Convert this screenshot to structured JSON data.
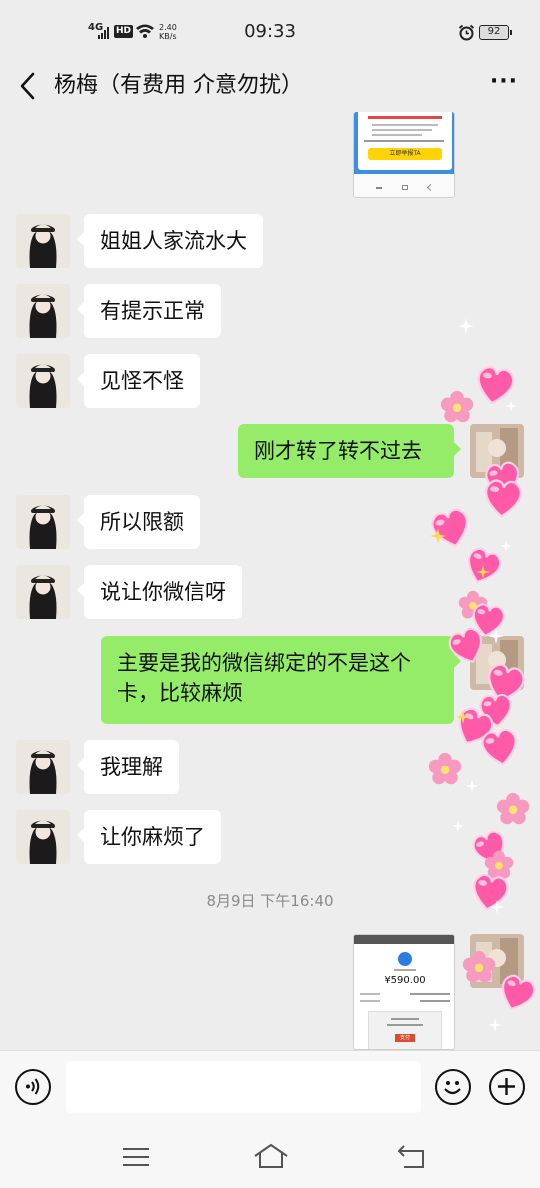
{
  "status_bar": {
    "network": "4G",
    "hd": "HD",
    "speed_value": "2.40",
    "speed_unit": "KB/s",
    "time": "09:33",
    "battery": "92"
  },
  "header": {
    "title": "杨梅（有费用 介意勿扰）",
    "more": "···"
  },
  "messages": [
    {
      "side": "left",
      "text": "姐姐人家流水大"
    },
    {
      "side": "left",
      "text": "有提示正常"
    },
    {
      "side": "left",
      "text": "见怪不怪"
    },
    {
      "side": "right",
      "text": "刚才转了转不过去"
    },
    {
      "side": "left",
      "text": "所以限额"
    },
    {
      "side": "left",
      "text": "说让你微信呀"
    },
    {
      "side": "right",
      "text": "主要是我的微信绑定的不是这个卡，比较麻烦"
    },
    {
      "side": "left",
      "text": "我理解"
    },
    {
      "side": "left",
      "text": "让你麻烦了"
    }
  ],
  "timestamp": "8月9日 下午16:40",
  "image_top": {
    "banner_button": "立即举报TA"
  },
  "image_bottom": {
    "amount": "¥590.00",
    "button": "支付"
  },
  "colors": {
    "background": "#ededed",
    "sent_bubble": "#95ec69",
    "received_bubble": "#ffffff",
    "sticker_pink": "#ff5aa8"
  },
  "icons": {
    "back": "chevron-left-icon",
    "more": "more-dots-icon",
    "voice": "voice-icon",
    "emoji": "emoji-icon",
    "plus": "plus-icon",
    "menu": "menu-icon",
    "home": "home-icon",
    "return": "return-icon"
  }
}
